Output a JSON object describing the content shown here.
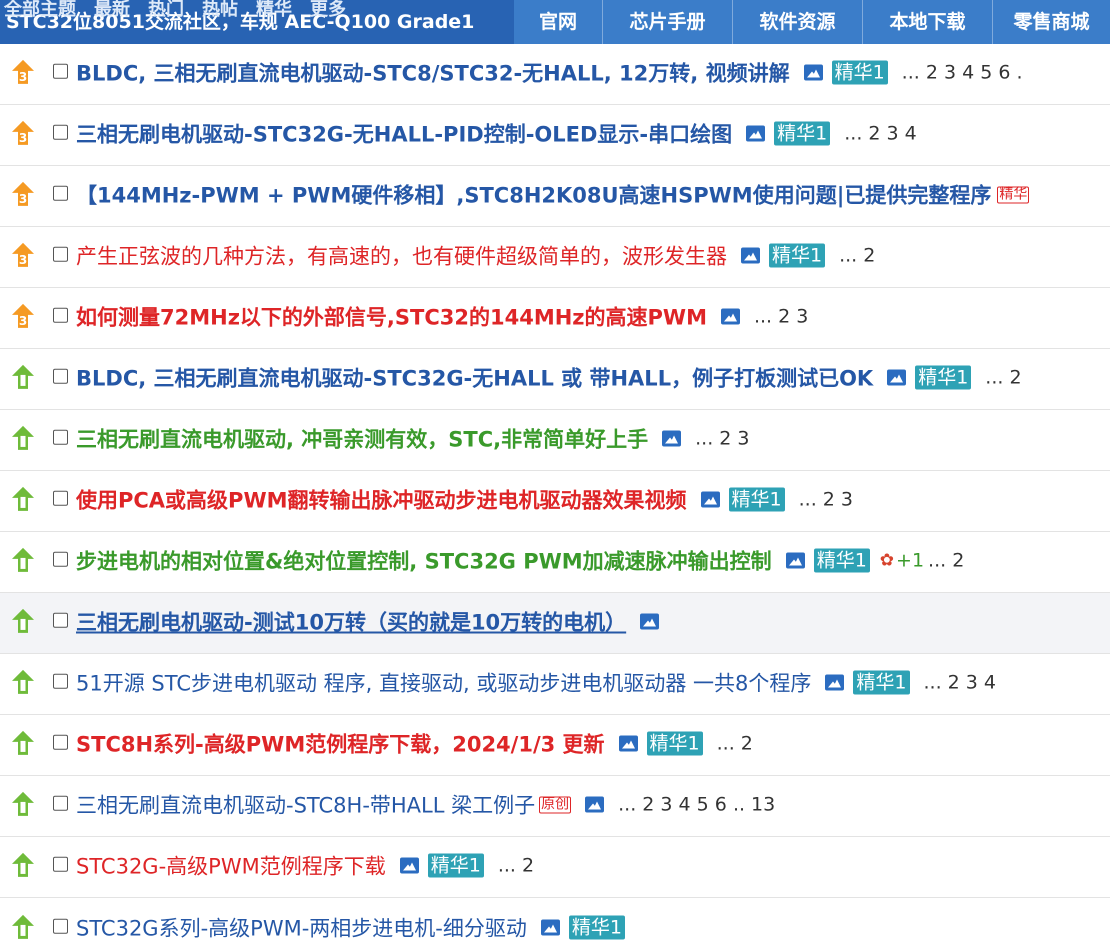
{
  "header": {
    "site_title": "STC32位8051交流社区，车规 AEC-Q100 Grade1",
    "sub_tabs": [
      "全部主题",
      "最新",
      "热门",
      "热帖",
      "精华",
      "更多"
    ],
    "nav": [
      "官网",
      "芯片手册",
      "软件资源",
      "本地下载",
      "零售商城"
    ]
  },
  "colors": {
    "header_bg": "#3b7dc9",
    "title_bg": "#2863b3",
    "badge": "#2ea2b5",
    "blue": "#2557a6",
    "red": "#de2527",
    "green": "#3a9a2b",
    "pin_orange": "#f59a23",
    "up_green": "#6fbb3a"
  },
  "threads": [
    {
      "icon": "pin-3-icon",
      "title": "BLDC, 三相无刷直流电机驱动-STC8/STC32-无HALL, 12万转, 视频讲解",
      "style": "blue bold",
      "image": true,
      "badge": "精华1",
      "pages": "... 2 3 4 5 6 ."
    },
    {
      "icon": "pin-3-icon",
      "title": "三相无刷电机驱动-STC32G-无HALL-PID控制-OLED显示-串口绘图",
      "style": "blue bold",
      "image": true,
      "badge": "精华1",
      "pages": "... 2 3 4"
    },
    {
      "icon": "pin-3-icon",
      "title": "【144MHz-PWM + PWM硬件移相】,STC8H2K08U高速HSPWM使用问题|已提供完整程序",
      "style": "blue bold",
      "image": false,
      "badge": "",
      "tag_cut": "精华",
      "pages": ""
    },
    {
      "icon": "pin-3-icon",
      "title": "产生正弦波的几种方法，有高速的，也有硬件超级简单的，波形发生器",
      "style": "red",
      "image": true,
      "badge": "精华1",
      "pages": "... 2"
    },
    {
      "icon": "pin-3-icon",
      "title": "如何测量72MHz以下的外部信号,STC32的144MHz的高速PWM",
      "style": "red bold",
      "image": true,
      "badge": "",
      "pages": "... 2 3"
    },
    {
      "icon": "up-arrow-icon",
      "title": "BLDC, 三相无刷直流电机驱动-STC32G-无HALL 或 带HALL，例子打板测试已OK",
      "style": "blue bold",
      "image": true,
      "badge": "精华1",
      "pages": "... 2"
    },
    {
      "icon": "up-arrow-icon",
      "title": "三相无刷直流电机驱动, 冲哥亲测有效，STC,非常简单好上手",
      "style": "green bold",
      "image": true,
      "badge": "",
      "pages": "... 2 3"
    },
    {
      "icon": "up-arrow-icon",
      "title": "使用PCA或高级PWM翻转输出脉冲驱动步进电机驱动器效果视频",
      "style": "red bold",
      "image": true,
      "badge": "精华1",
      "pages": "... 2 3"
    },
    {
      "icon": "up-arrow-icon",
      "title": "步进电机的相对位置&绝对位置控制, STC32G PWM加减速脉冲输出控制",
      "style": "green bold",
      "image": true,
      "badge": "精华1",
      "flower": "+1",
      "pages": "... 2"
    },
    {
      "icon": "up-arrow-icon",
      "title": "三相无刷电机驱动-测试10万转（买的就是10万转的电机）",
      "style": "blue bold under",
      "image": true,
      "badge": "",
      "pages": "",
      "highlight": true
    },
    {
      "icon": "up-arrow-icon",
      "title": "51开源 STC步进电机驱动 程序, 直接驱动, 或驱动步进电机驱动器 一共8个程序",
      "style": "blue",
      "image": true,
      "badge": "精华1",
      "pages": "... 2 3 4"
    },
    {
      "icon": "up-arrow-icon",
      "title": "STC8H系列-高级PWM范例程序下载，2024/1/3 更新",
      "style": "red bold",
      "image": true,
      "badge": "精华1",
      "pages": "... 2"
    },
    {
      "icon": "up-arrow-icon",
      "title": "三相无刷直流电机驱动-STC8H-带HALL 梁工例子",
      "style": "blue",
      "image": true,
      "badge": "",
      "tag": "原创",
      "pages": "... 2 3 4 5 6 .. 13"
    },
    {
      "icon": "up-arrow-icon",
      "title": "STC32G-高级PWM范例程序下载",
      "style": "red",
      "image": true,
      "badge": "精华1",
      "pages": "... 2"
    },
    {
      "icon": "up-arrow-icon",
      "title": "STC32G系列-高级PWM-两相步进电机-细分驱动",
      "style": "blue",
      "image": true,
      "badge": "精华1",
      "pages": ""
    }
  ]
}
